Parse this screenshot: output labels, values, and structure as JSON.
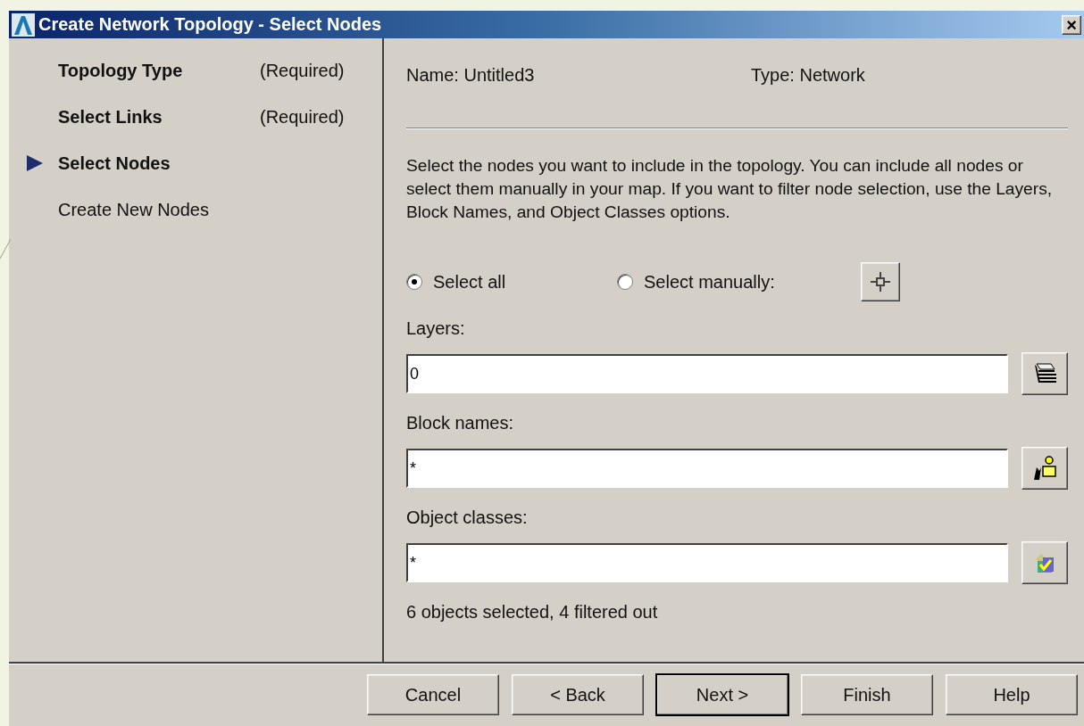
{
  "window": {
    "title": "Create Network Topology - Select Nodes",
    "close": "×"
  },
  "steps": [
    {
      "label": "Topology Type",
      "note": "(Required)",
      "kind": "required",
      "selected": false
    },
    {
      "label": "Select Links",
      "note": "(Required)",
      "kind": "required",
      "selected": false
    },
    {
      "label": "Select Nodes",
      "kind": "required",
      "selected": true
    },
    {
      "label": "Create New Nodes",
      "kind": "optional",
      "selected": false
    }
  ],
  "info": {
    "name": "Name: Untitled3",
    "type": "Type: Network"
  },
  "description": "Select the nodes you want to include in the topology. You can include all nodes or select them manually in your map. If you want to filter node selection, use the Layers, Block Names, and Object Classes options.",
  "selection": [
    {
      "label": "Select all",
      "selected": true
    },
    {
      "label": "Select manually:",
      "selected": false
    }
  ],
  "filters": [
    {
      "label": "Layers:",
      "value": "0",
      "kind": "layers"
    },
    {
      "label": "Block names:",
      "value": "*",
      "kind": "blocks"
    },
    {
      "label": "Object classes:",
      "value": "*",
      "kind": "classes"
    }
  ],
  "status": "6 objects selected, 4 filtered out",
  "buttons": [
    {
      "label": "Cancel",
      "default": false
    },
    {
      "label": "< Back",
      "default": false
    },
    {
      "label": "Next >",
      "default": true
    },
    {
      "label": "Finish",
      "default": false
    },
    {
      "label": "Help",
      "default": false
    }
  ]
}
